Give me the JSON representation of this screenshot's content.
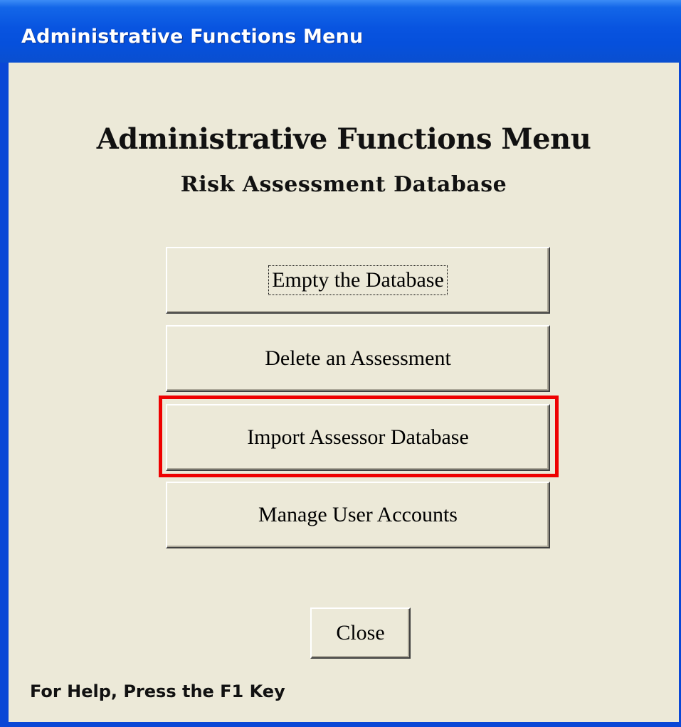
{
  "window": {
    "title": "Administrative Functions Menu"
  },
  "form": {
    "heading": "Administrative Functions Menu",
    "subheading": "Risk Assessment Database",
    "buttons": [
      {
        "label": "Empty the Database",
        "focused": true
      },
      {
        "label": "Delete an Assessment",
        "focused": false
      },
      {
        "label": "Import Assessor Database",
        "highlighted": true
      },
      {
        "label": "Manage User Accounts",
        "focused": false
      }
    ],
    "close_label": "Close",
    "status_text": "For Help, Press the F1 Key"
  },
  "colors": {
    "titlebar": "#0854e0",
    "client_background": "#ece9d8",
    "highlight": "#ee0000"
  }
}
